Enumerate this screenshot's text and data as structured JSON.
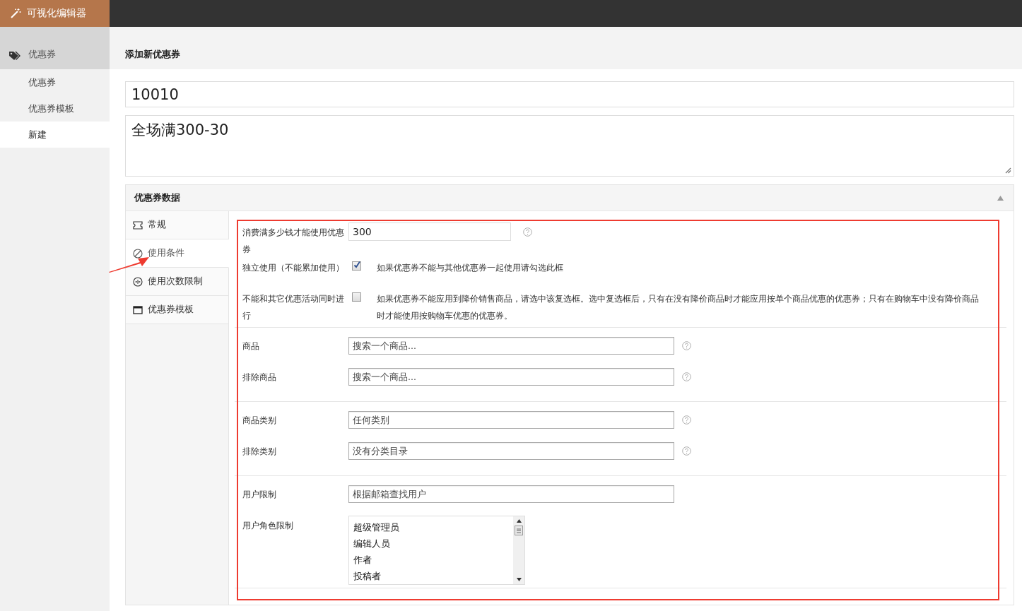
{
  "brand": {
    "label": "可视化编辑器"
  },
  "sidebar": {
    "section": {
      "label": "优惠券"
    },
    "items": [
      {
        "label": "优惠券",
        "selected": false
      },
      {
        "label": "优惠券模板",
        "selected": false
      },
      {
        "label": "新建",
        "selected": true
      }
    ]
  },
  "page": {
    "title": "添加新优惠券",
    "code": "10010",
    "description": "全场满300-30"
  },
  "panel": {
    "title": "优惠券数据",
    "expanded": true,
    "tabs": [
      {
        "label": "常规",
        "kind": "ticket",
        "selected": false
      },
      {
        "label": "使用条件",
        "kind": "ban",
        "selected": true
      },
      {
        "label": "使用次数限制",
        "kind": "counter",
        "selected": false
      },
      {
        "label": "优惠券模板",
        "kind": "window",
        "selected": false
      }
    ],
    "groups": [
      {
        "rows": [
          {
            "kind": "number",
            "label": "消费满多少钱才能使用优惠券",
            "value": "300",
            "help": true
          },
          {
            "kind": "checkbox",
            "label": "独立使用（不能累加使用）",
            "checked": true,
            "description": "如果优惠券不能与其他优惠券一起使用请勾选此框"
          },
          {
            "kind": "checkbox",
            "label": "不能和其它优惠活动同时进行",
            "checked": false,
            "description": "如果优惠券不能应用到降价销售商品，请选中该复选框。选中复选框后，只有在没有降价商品时才能应用按单个商品优惠的优惠券；只有在购物车中没有降价商品时才能使用按购物车优惠的优惠券。"
          }
        ]
      },
      {
        "rows": [
          {
            "kind": "search",
            "label": "商品",
            "placeholder": "搜索一个商品...",
            "help": true
          },
          {
            "kind": "search",
            "label": "排除商品",
            "placeholder": "搜索一个商品...",
            "help": true
          }
        ]
      },
      {
        "rows": [
          {
            "kind": "search",
            "label": "商品类别",
            "placeholder": "任何类别",
            "help": true
          },
          {
            "kind": "search",
            "label": "排除类别",
            "placeholder": "没有分类目录",
            "help": true
          }
        ]
      },
      {
        "rows": [
          {
            "kind": "search",
            "label": "用户限制",
            "placeholder": "根据邮箱查找用户",
            "help": false
          },
          {
            "kind": "listbox",
            "label": "用户角色限制",
            "options": [
              "超级管理员",
              "编辑人员",
              "作者",
              "投稿者"
            ]
          }
        ]
      }
    ]
  }
}
